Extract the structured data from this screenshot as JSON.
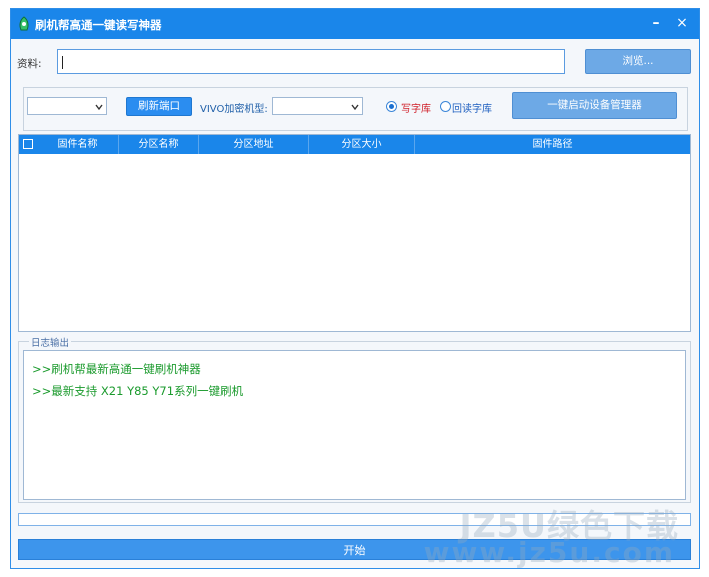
{
  "window": {
    "title": "刷机帮高通一键读写神器",
    "minimize": "–",
    "close": "×"
  },
  "file_row": {
    "label": "资料:",
    "value": "",
    "browse_label": "浏览..."
  },
  "options": {
    "port_select_value": "",
    "refresh_port_label": "刷新端口",
    "vivo_label": "VIVO加密机型:",
    "vivo_select_value": "",
    "radio_write_label": "写字库",
    "radio_read_label": "回读字库",
    "write_checked": true,
    "device_manager_label": "一键启动设备管理器"
  },
  "table": {
    "columns": [
      "固件名称",
      "分区名称",
      "分区地址",
      "分区大小",
      "固件路径"
    ],
    "rows": []
  },
  "log": {
    "title": "日志输出",
    "lines": [
      ">>刷机帮最新高通一键刷机神器",
      ">>最新支持 X21 Y85 Y71系列一键刷机"
    ]
  },
  "progress": {
    "value": 0
  },
  "start_label": "开始",
  "watermark": {
    "line1": "JZ5U绿色下载",
    "line2": "www.jz5u.com"
  },
  "colors": {
    "accent": "#1a86ea",
    "log_text": "#1a9a2c",
    "radio_write": "#d0202a",
    "radio_read": "#2060c0"
  }
}
